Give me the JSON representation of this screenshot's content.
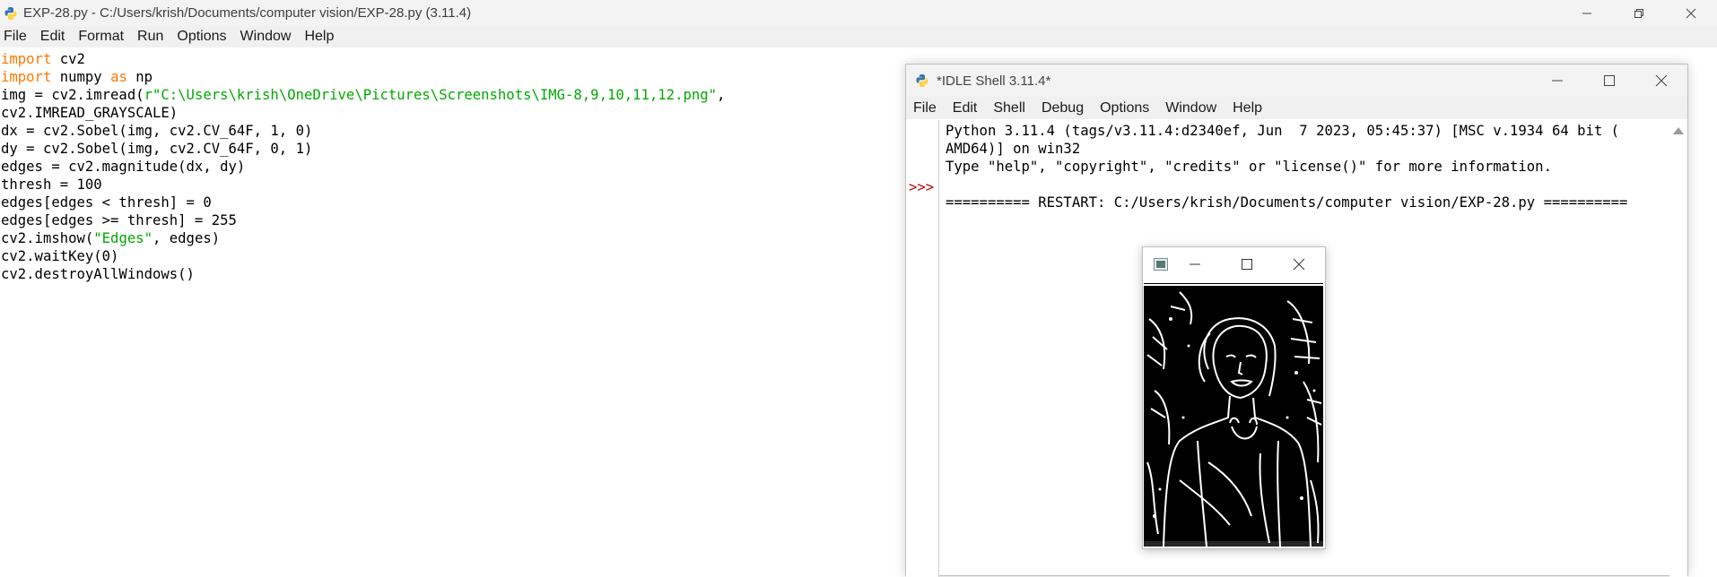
{
  "editor": {
    "title": "EXP-28.py - C:/Users/krish/Documents/computer vision/EXP-28.py (3.11.4)",
    "menu": [
      "File",
      "Edit",
      "Format",
      "Run",
      "Options",
      "Window",
      "Help"
    ],
    "code": [
      [
        [
          "kw",
          "import"
        ],
        [
          "",
          " cv2"
        ]
      ],
      [
        [
          "kw",
          "import"
        ],
        [
          "",
          " numpy "
        ],
        [
          "kw",
          "as"
        ],
        [
          "",
          " np"
        ]
      ],
      [
        [
          "",
          "img = cv2.imread("
        ],
        [
          "str",
          "r\"C:\\Users\\krish\\OneDrive\\Pictures\\Screenshots\\IMG-8,9,10,11,12.png\""
        ],
        [
          "",
          ","
        ]
      ],
      [
        [
          "",
          "cv2.IMREAD_GRAYSCALE)"
        ]
      ],
      [
        [
          "",
          "dx = cv2.Sobel(img, cv2.CV_64F, 1, 0)"
        ]
      ],
      [
        [
          "",
          "dy = cv2.Sobel(img, cv2.CV_64F, 0, 1)"
        ]
      ],
      [
        [
          "",
          "edges = cv2.magnitude(dx, dy)"
        ]
      ],
      [
        [
          "",
          "thresh = 100"
        ]
      ],
      [
        [
          "",
          "edges[edges < thresh] = 0"
        ]
      ],
      [
        [
          "",
          "edges[edges >= thresh] = 255"
        ]
      ],
      [
        [
          "",
          "cv2.imshow("
        ],
        [
          "str",
          "\"Edges\""
        ],
        [
          "",
          ", edges)"
        ]
      ],
      [
        [
          "",
          "cv2.waitKey(0)"
        ]
      ],
      [
        [
          "",
          "cv2.destroyAllWindows()"
        ]
      ]
    ]
  },
  "shell": {
    "title": "*IDLE Shell 3.11.4*",
    "menu": [
      "File",
      "Edit",
      "Shell",
      "Debug",
      "Options",
      "Window",
      "Help"
    ],
    "prompt": ">>>",
    "output": "Python 3.11.4 (tags/v3.11.4:d2340ef, Jun  7 2023, 05:45:37) [MSC v.1934 64 bit (\nAMD64)] on win32\nType \"help\", \"copyright\", \"credits\" or \"license()\" for more information.\n\n========== RESTART: C:/Users/krish/Documents/computer vision/EXP-28.py =========="
  },
  "image_window": {
    "content": "edge-detected grayscale portrait (white edges on black)"
  },
  "colors": {
    "keyword": "#ff7700",
    "string": "#00aa00",
    "prompt": "#c00000",
    "titlebar": "#f3f3f3"
  }
}
